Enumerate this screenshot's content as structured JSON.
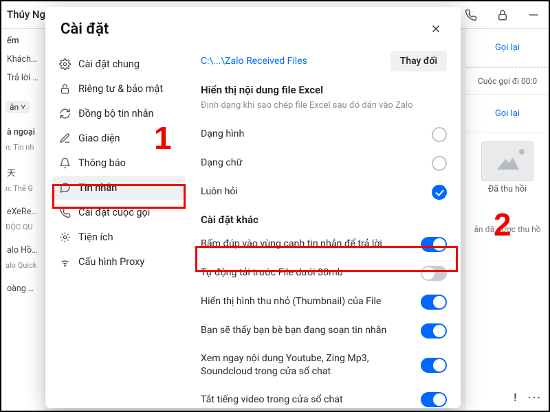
{
  "background": {
    "header_name": "Thúy Ng",
    "search_hint": "ếm",
    "sidebar": {
      "r1": {
        "t": "Khách hàn"
      },
      "r2": {
        "t": "Trả lời sa"
      },
      "badge": "ắn  ˅",
      "r3": {
        "t": "à ngoại",
        "s": "n: Tin nh"
      },
      "r4": {
        "t": "天",
        "s": "n: Thế G"
      },
      "r5": {
        "t": "eXeRe Đ",
        "s": "ĐỘC QU"
      },
      "r6": {
        "t": "alo Hồ T",
        "s": "alo Quick"
      },
      "r7": {
        "t": "oàng Tru"
      }
    },
    "right": {
      "c1": "Gọi lại",
      "c2": "Cuộc gọi đi 00:0",
      "c3": "Gọi lại",
      "thumb_label": "Đã thu hồi",
      "hint": "ắn đã được thu hồ",
      "excl": "!",
      "dots": "···"
    }
  },
  "modal": {
    "title": "Cài đặt",
    "sidebar": [
      {
        "key": "general",
        "label": "Cài đặt chung"
      },
      {
        "key": "privacy",
        "label": "Riêng tư & bảo mật"
      },
      {
        "key": "sync",
        "label": "Đồng bộ tin nhắn"
      },
      {
        "key": "appearance",
        "label": "Giao diện"
      },
      {
        "key": "notify",
        "label": "Thông báo"
      },
      {
        "key": "messages",
        "label": "Tin nhắn"
      },
      {
        "key": "calls",
        "label": "Cài đặt cuộc gọi"
      },
      {
        "key": "util",
        "label": "Tiện ích"
      },
      {
        "key": "proxy",
        "label": "Cấu hình Proxy"
      }
    ],
    "path": "C:\\...\\Zalo Received Files",
    "change_btn": "Thay đổi",
    "excel_title": "Hiển thị nội dung file Excel",
    "excel_desc": "Định dạng khi sao chép file Excel sau đó dán vào Zalo",
    "excel_opts": {
      "image": "Dạng hình",
      "text": "Dạng chữ",
      "ask": "Luôn hỏi"
    },
    "other_title": "Cài đặt khác",
    "other": {
      "dblclick": "Bấm đúp vào vùng cạnh tin nhắn để trả lời",
      "autoload": "Tự động tải trước File dưới 30mb",
      "thumb": "Hiển thị hình thu nhỏ (Thumbnail) của File",
      "typing": "Bạn sẽ thấy bạn bè bạn đang soạn tin nhắn",
      "preview": "Xem ngay nội dung Youtube, Zing Mp3, Soundcloud trong cửa sổ chat",
      "mute": "Tắt tiếng video trong cửa sổ chat"
    }
  },
  "annotations": {
    "n1": "1",
    "n2": "2"
  }
}
